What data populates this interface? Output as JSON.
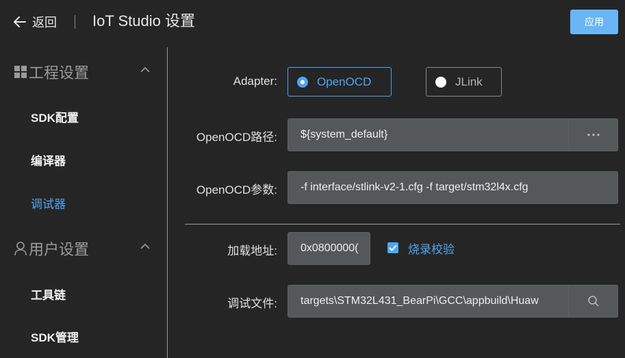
{
  "header": {
    "back_label": "返回",
    "title": "IoT Studio 设置",
    "apply_label": "应用"
  },
  "sidebar": {
    "groups": [
      {
        "label": "工程设置",
        "icon": "grid-icon",
        "expanded": true,
        "items": [
          {
            "label": "SDK配置",
            "active": false
          },
          {
            "label": "编译器",
            "active": false
          },
          {
            "label": "调试器",
            "active": true
          }
        ]
      },
      {
        "label": "用户设置",
        "icon": "user-icon",
        "expanded": true,
        "items": [
          {
            "label": "工具链",
            "active": false
          },
          {
            "label": "SDK管理",
            "active": false
          }
        ]
      }
    ]
  },
  "form": {
    "adapter": {
      "label": "Adapter:",
      "options": [
        {
          "label": "OpenOCD",
          "selected": true
        },
        {
          "label": "JLink",
          "selected": false
        }
      ]
    },
    "openocd_path": {
      "label": "OpenOCD路径:",
      "value": "${system_default}",
      "button_icon": "more-icon"
    },
    "openocd_args": {
      "label": "OpenOCD参数:",
      "value": "-f interface/stlink-v2-1.cfg -f target/stm32l4x.cfg"
    },
    "load_address": {
      "label": "加载地址:",
      "value": "0x0800000("
    },
    "flash_verify": {
      "label": "烧录校验",
      "checked": true
    },
    "debug_file": {
      "label": "调试文件:",
      "value": "targets\\STM32L431_BearPi\\GCC\\appbuild\\Huaw",
      "button_icon": "search-icon"
    }
  },
  "colors": {
    "background": "#252526",
    "accent": "#4ea6f0",
    "apply_button": "#6ab6f5",
    "field_background": "#555858"
  }
}
